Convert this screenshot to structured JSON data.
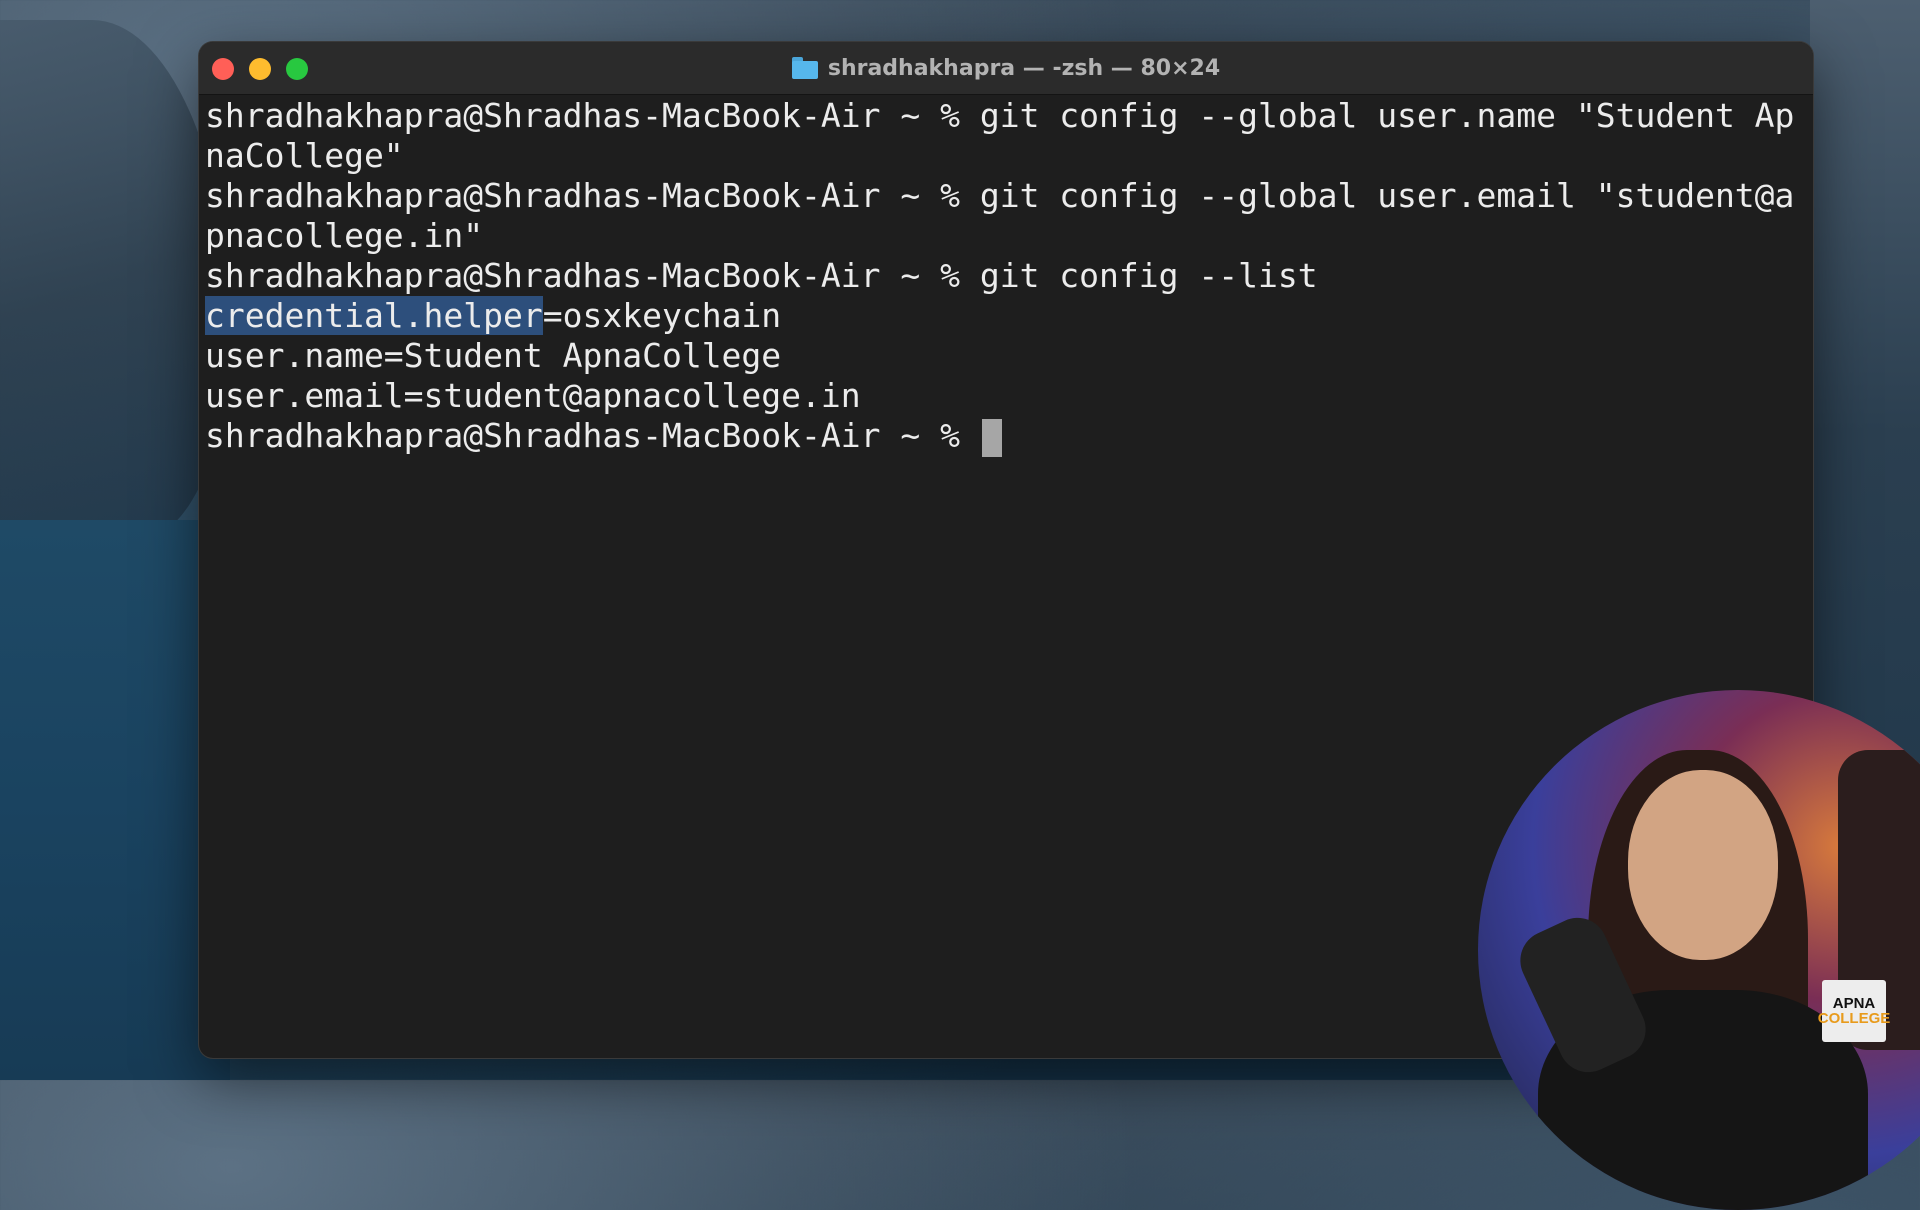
{
  "window": {
    "title": "shradhakhapra — -zsh — 80×24"
  },
  "terminal": {
    "lines": [
      "shradhakhapra@Shradhas-MacBook-Air ~ % git config --global user.name \"Student Ap",
      "naCollege\"",
      "shradhakhapra@Shradhas-MacBook-Air ~ % git config --global user.email \"student@a",
      "pnacollege.in\"",
      "shradhakhapra@Shradhas-MacBook-Air ~ % git config --list",
      {
        "selected": "credential.helper",
        "rest": "=osxkeychain"
      },
      "user.name=Student ApnaCollege",
      "user.email=student@apnacollege.in",
      "shradhakhapra@Shradhas-MacBook-Air ~ % "
    ]
  },
  "logo": {
    "line1": "APNA",
    "line2": "COLLEGE"
  },
  "colors": {
    "terminal_bg": "#1e1e1e",
    "selection": "#2d4f7c",
    "close": "#ff5f57",
    "minimize": "#febc2e",
    "maximize": "#28c840"
  }
}
